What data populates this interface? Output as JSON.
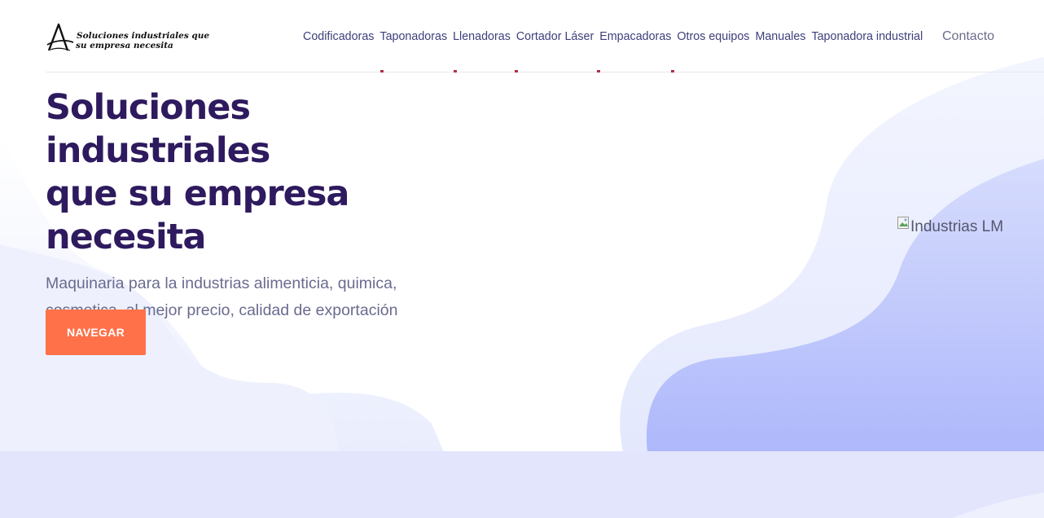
{
  "logo": {
    "line1": "Soluciones industriales que",
    "line2": "su empresa necesita"
  },
  "nav": {
    "items": [
      {
        "label": "Codificadoras"
      },
      {
        "label": "Taponadoras"
      },
      {
        "label": "Llenadoras"
      },
      {
        "label": "Cortador Láser"
      },
      {
        "label": "Empacadoras"
      },
      {
        "label": "Otros equipos"
      },
      {
        "label": "Manuales"
      },
      {
        "label": "Taponadora industrial"
      }
    ],
    "contact": "Contacto"
  },
  "hero": {
    "title_line1": "Soluciones industriales",
    "title_line2": "que su empresa",
    "title_line3": "necesita",
    "subtitle": "Maquinaria para la industrias alimenticia, quimica, cosmetica, al mejor precio, calidad de exportación",
    "cta_label": "NAVEGAR"
  },
  "hero_image": {
    "alt": "Industrias LM",
    "icon": "broken-image-icon"
  },
  "colors": {
    "heading": "#2e1a5e",
    "nav_text": "#3d3f7a",
    "cta": "#ff7149",
    "wave_light": "#e6e8fb",
    "wave_blue": "#b3bdfb"
  }
}
